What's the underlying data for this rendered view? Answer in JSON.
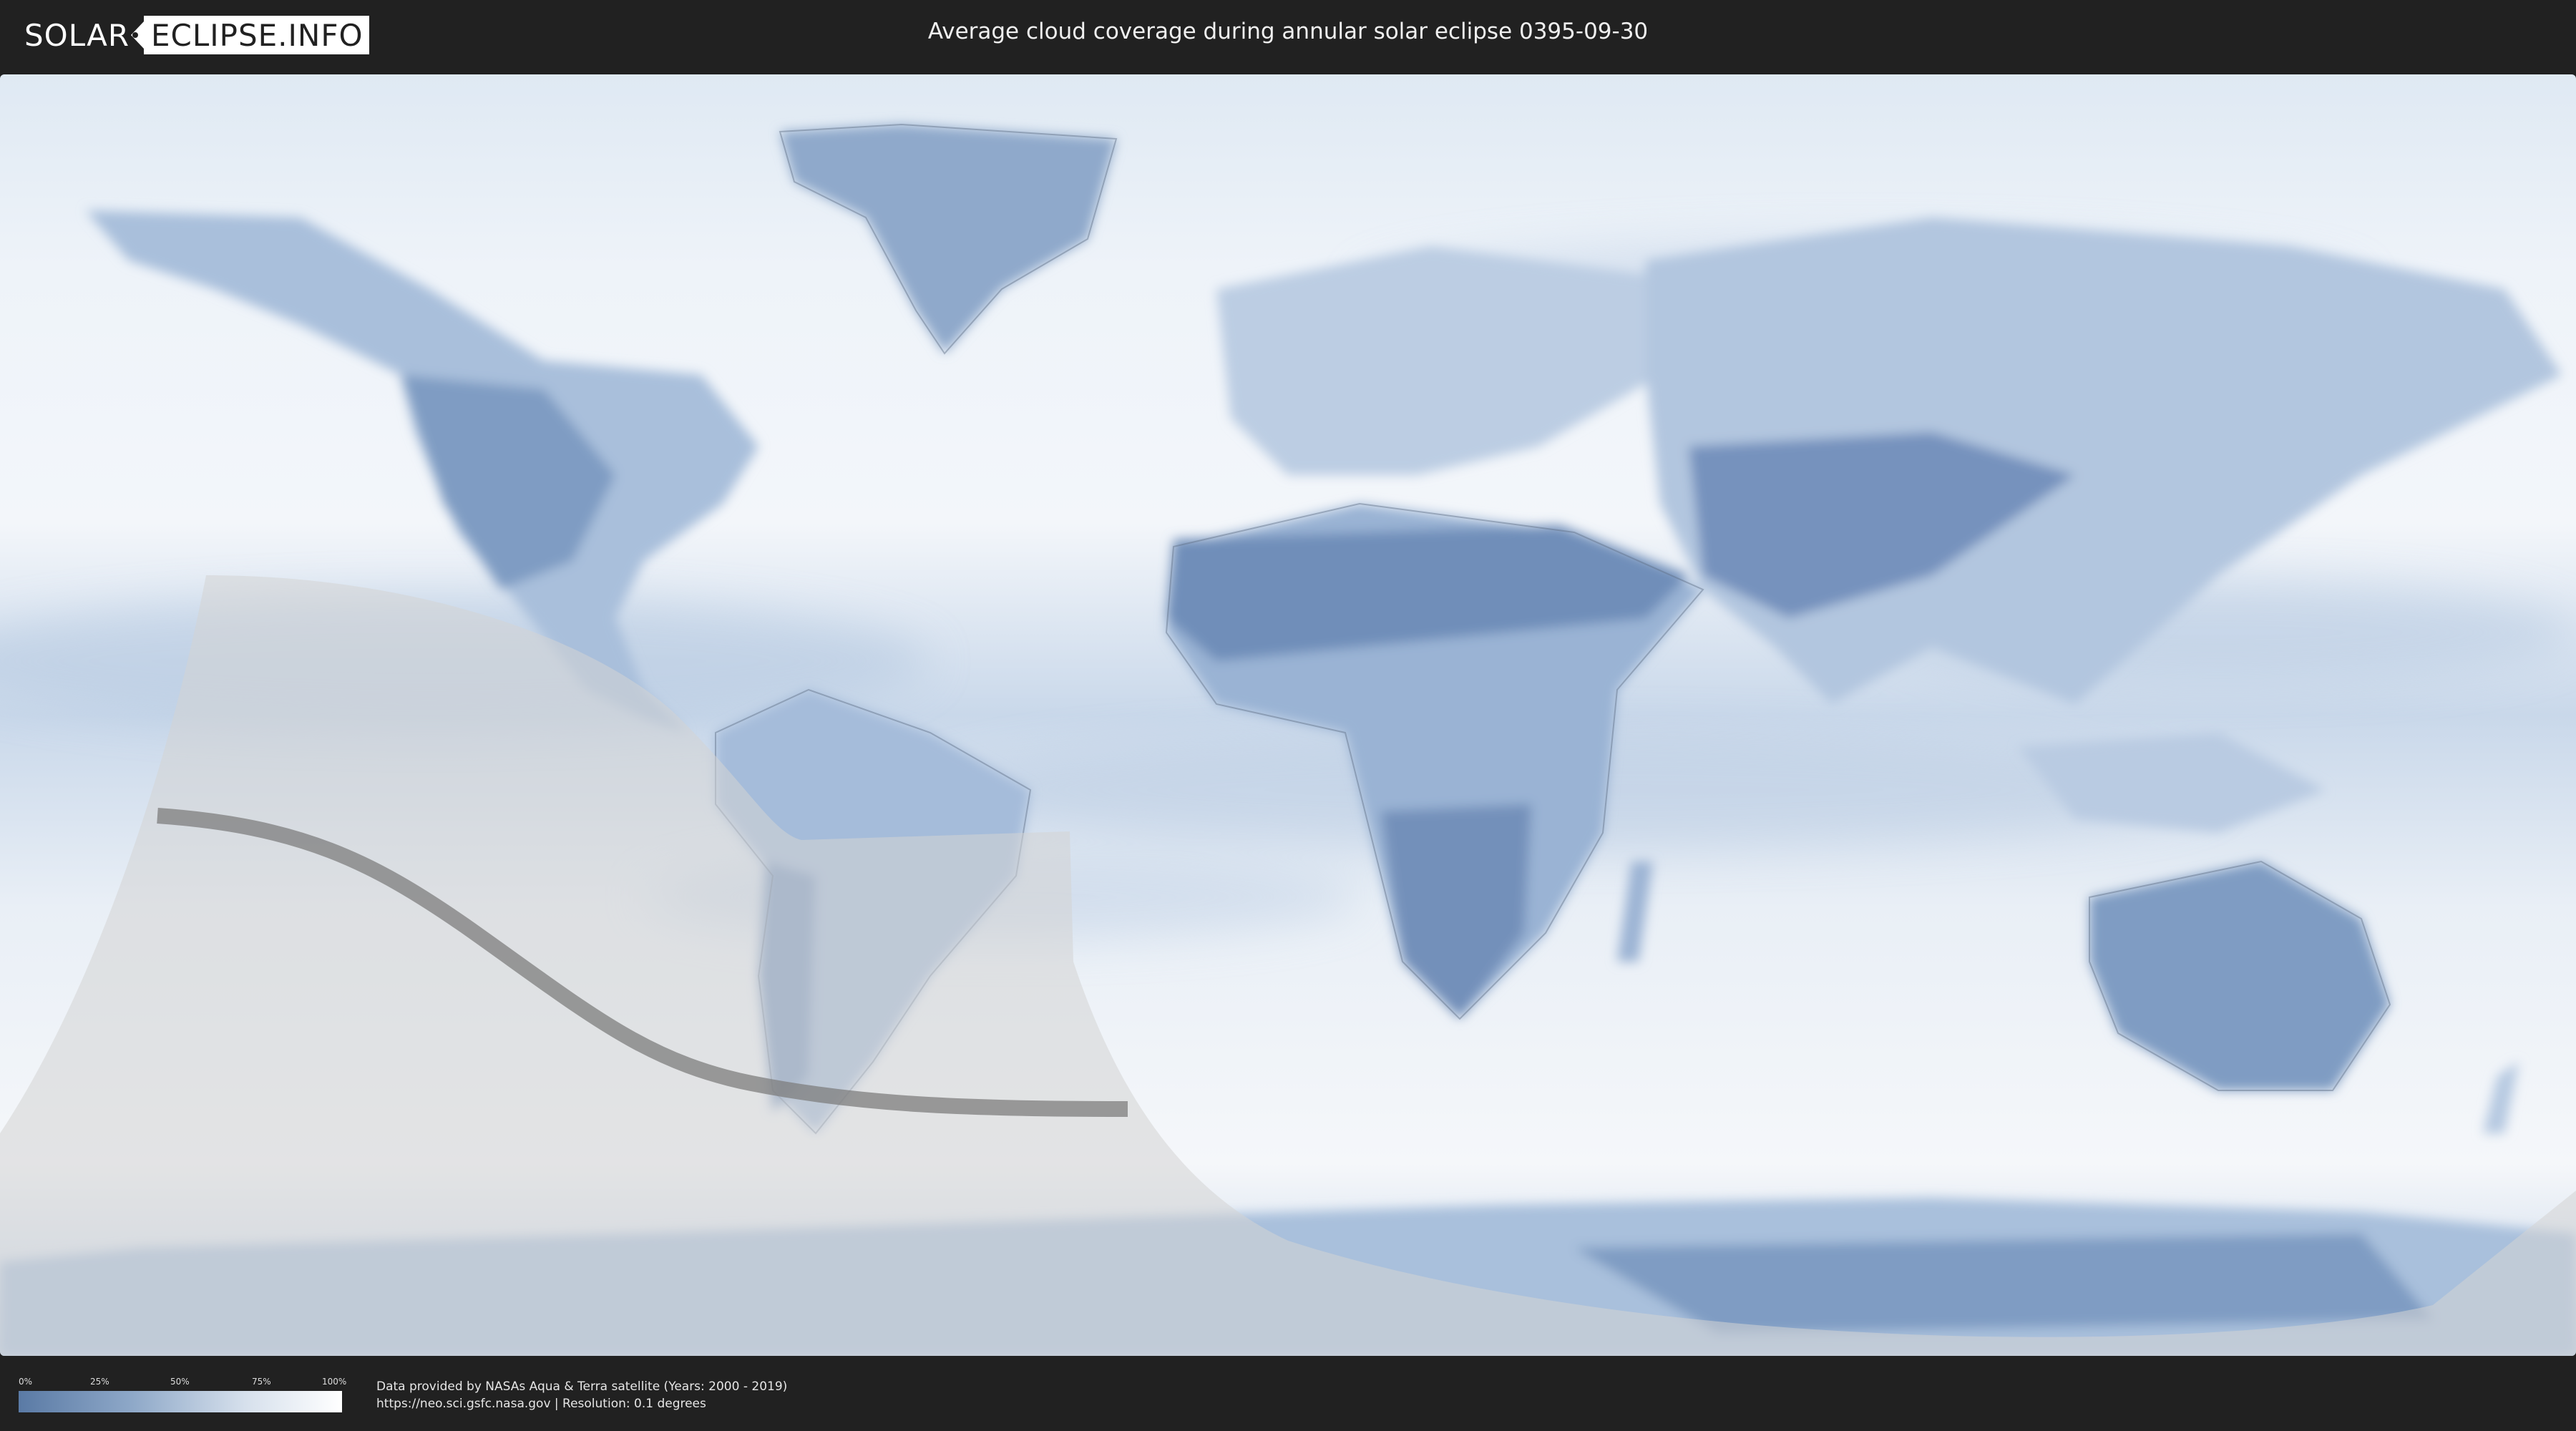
{
  "header": {
    "logo_left": "SOLAR",
    "logo_right": "ECLIPSE.INFO",
    "title": "Average cloud coverage during annular solar eclipse 0395-09-30"
  },
  "map": {
    "projection": "equirectangular world map",
    "layer": "average cloud coverage",
    "eclipse_type": "annular",
    "colors": {
      "clear": "#5a7aa5",
      "cloudy": "#ffffff",
      "eclipse_zone_overlay": "#d8d8d8",
      "central_path": "#7d7d7d",
      "background": "#212121"
    }
  },
  "legend": {
    "ticks": [
      "0%",
      "25%",
      "50%",
      "75%",
      "100%"
    ]
  },
  "footer": {
    "credit_line1": "Data provided by NASAs Aqua & Terra satellite (Years: 2000 - 2019)",
    "credit_line2": "https://neo.sci.gsfc.nasa.gov | Resolution: 0.1 degrees"
  }
}
